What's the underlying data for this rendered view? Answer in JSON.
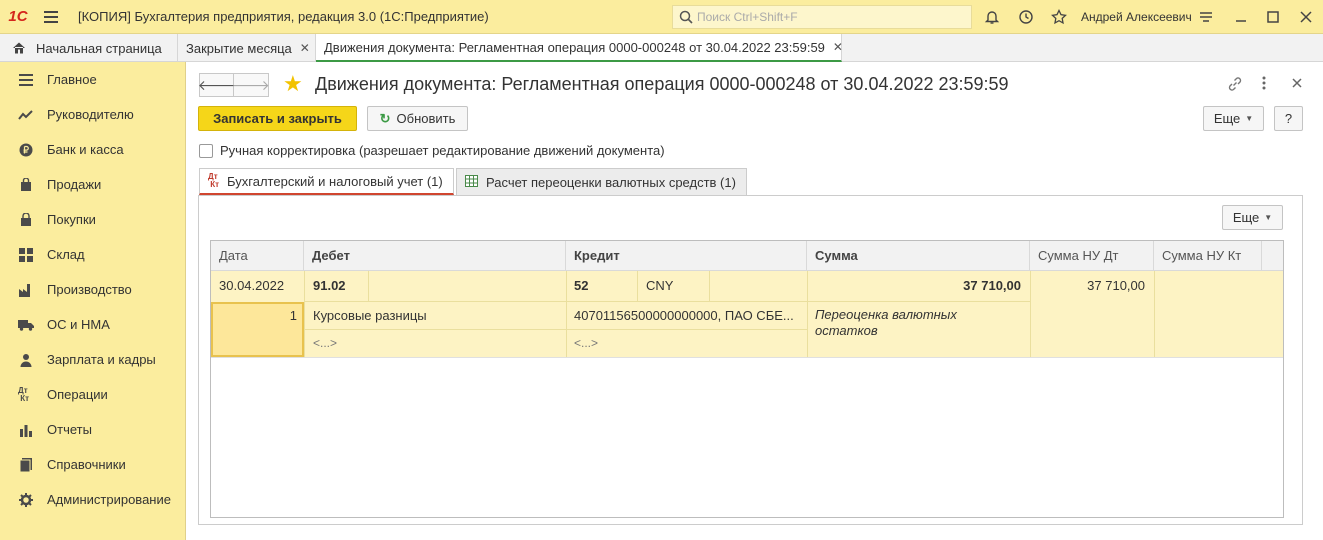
{
  "app": {
    "logo": "1С",
    "title": "[КОПИЯ] Бухгалтерия предприятия, редакция 3.0  (1С:Предприятие)",
    "search_placeholder": "Поиск Ctrl+Shift+F",
    "user": "Андрей Алексеевич"
  },
  "tabs": [
    {
      "label": "Начальная страница"
    },
    {
      "label": "Закрытие месяца"
    },
    {
      "label": "Движения документа: Регламентная операция 0000-000248 от 30.04.2022 23:59:59"
    }
  ],
  "sidebar": {
    "items": [
      {
        "label": "Главное",
        "icon": "menu-icon"
      },
      {
        "label": "Руководителю",
        "icon": "trend-icon"
      },
      {
        "label": "Банк и касса",
        "icon": "ruble-icon"
      },
      {
        "label": "Продажи",
        "icon": "bag-icon"
      },
      {
        "label": "Покупки",
        "icon": "cart-icon"
      },
      {
        "label": "Склад",
        "icon": "warehouse-icon"
      },
      {
        "label": "Производство",
        "icon": "factory-icon"
      },
      {
        "label": "ОС и НМА",
        "icon": "truck-icon"
      },
      {
        "label": "Зарплата и кадры",
        "icon": "person-icon"
      },
      {
        "label": "Операции",
        "icon": "dtkt-icon"
      },
      {
        "label": "Отчеты",
        "icon": "barchart-icon"
      },
      {
        "label": "Справочники",
        "icon": "book-icon"
      },
      {
        "label": "Администрирование",
        "icon": "gear-icon"
      }
    ]
  },
  "doc": {
    "title": "Движения документа: Регламентная операция 0000-000248 от 30.04.2022 23:59:59",
    "save_close": "Записать и закрыть",
    "refresh": "Обновить",
    "more": "Еще",
    "help": "?",
    "manual_edit": "Ручная корректировка (разрешает редактирование движений документа)",
    "subtab_dtkt": "Дт\nКт",
    "subtabs": [
      "Бухгалтерский и налоговый учет (1)",
      "Расчет переоценки валютных средств (1)"
    ],
    "panel_more": "Еще"
  },
  "table": {
    "headers": {
      "date": "Дата",
      "debit": "Дебет",
      "credit": "Кредит",
      "sum": "Сумма",
      "sum_nu_dt": "Сумма НУ Дт",
      "sum_nu_kt": "Сумма НУ Кт"
    },
    "row": {
      "date": "30.04.2022",
      "debit_account": "91.02",
      "credit_account": "52",
      "credit_currency": "CNY",
      "sum": "37 710,00",
      "sum_nu_dt": "37 710,00",
      "line_no": "1",
      "debit_subconto1": "Курсовые разницы",
      "debit_subconto2": "<...>",
      "credit_subconto1": "40701156500000000000, ПАО СБЕ...",
      "credit_subconto2": "<...>",
      "content": "Переоценка валютных остатков"
    }
  }
}
